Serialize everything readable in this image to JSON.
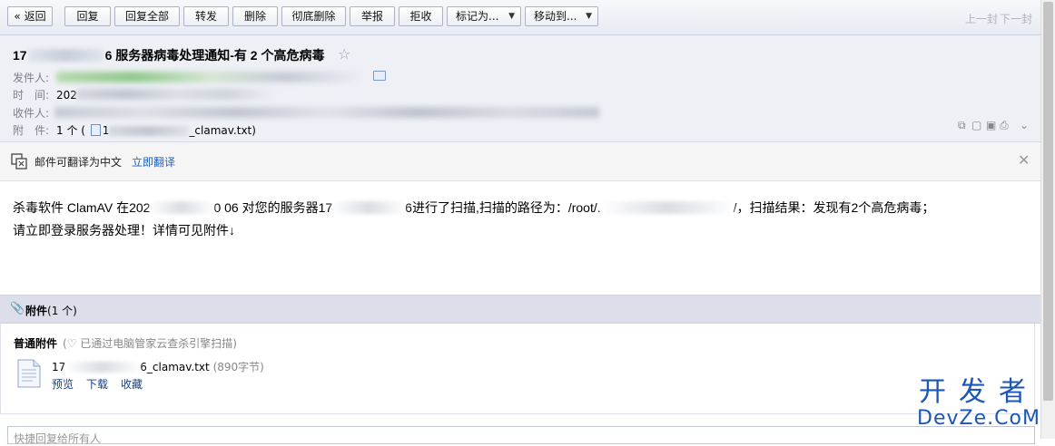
{
  "toolbar": {
    "back": "« 返回",
    "reply": "回复",
    "reply_all": "回复全部",
    "forward": "转发",
    "delete": "删除",
    "delete_forever": "彻底删除",
    "report": "举报",
    "reject": "拒收",
    "mark_as": "标记为...",
    "move_to": "移动到...",
    "prev": "上一封",
    "next": "下一封"
  },
  "header": {
    "subject_prefix": "17",
    "subject_suffix": "6 服务器病毒处理通知-有 2 个高危病毒",
    "from_label": "发件人:",
    "time_label": "时　间:",
    "time_visible": "202",
    "to_label": "收件人:",
    "attach_label": "附　件:",
    "attach_count": "1 个 (",
    "attach_prefix": "1",
    "attach_suffix": "_clamav.txt)"
  },
  "translate": {
    "text": "邮件可翻译为中文",
    "link": "立即翻译"
  },
  "body": {
    "p1_a": "杀毒软件 ClamAV 在202",
    "p1_b": "0 06 对您的服务器17",
    "p1_c": "6进行了扫描,扫描的路径为：/root/.",
    "p1_d": "/，扫描结果：发现有2个高危病毒；",
    "p2": "请立即登录服务器处理！详情可见附件↓"
  },
  "attachments": {
    "title_bold": "附件",
    "title_count": "(1 个)",
    "kind": "普通附件",
    "scan_note": "已通过电脑管家云查杀引擎扫描)",
    "file_prefix": "17",
    "file_suffix": "6_clamav.txt",
    "file_size": "(890字节)",
    "preview": "预览",
    "download": "下载",
    "favorite": "收藏"
  },
  "reply_box": {
    "placeholder": "快捷回复给所有人"
  },
  "watermark": {
    "cn": "开发者",
    "en": "DevZe.CoM"
  }
}
